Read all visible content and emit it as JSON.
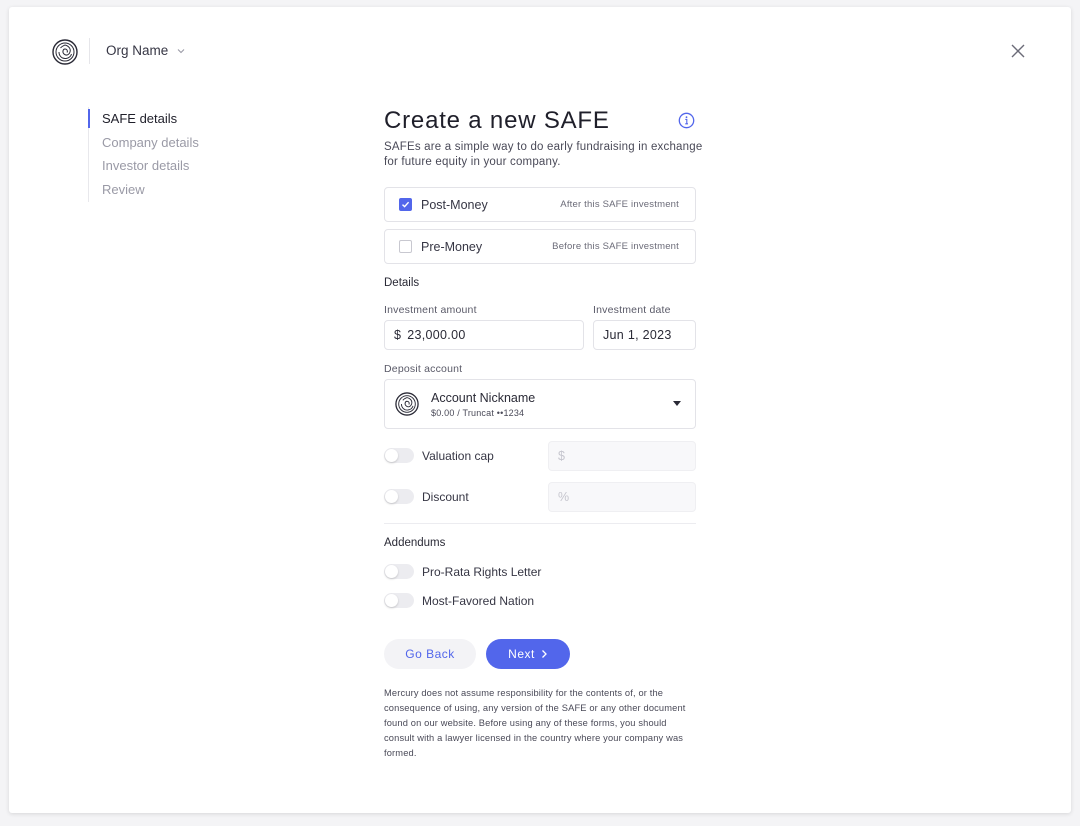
{
  "header": {
    "org_name": "Org Name"
  },
  "steps": [
    {
      "label": "SAFE details",
      "active": true
    },
    {
      "label": "Company details",
      "active": false
    },
    {
      "label": "Investor details",
      "active": false
    },
    {
      "label": "Review",
      "active": false
    }
  ],
  "form": {
    "title": "Create a new SAFE",
    "subtitle": "SAFEs are a simple way to do early fundraising in exchange for future equity in your company.",
    "options": [
      {
        "label": "Post-Money",
        "hint": "After this SAFE investment",
        "checked": true
      },
      {
        "label": "Pre-Money",
        "hint": "Before this SAFE investment",
        "checked": false
      }
    ],
    "details_label": "Details",
    "investment_amount": {
      "label": "Investment amount",
      "prefix": "$",
      "value": "23,000.00"
    },
    "investment_date": {
      "label": "Investment date",
      "value": "Jun 1, 2023"
    },
    "deposit_account": {
      "label": "Deposit account",
      "name": "Account Nickname",
      "sub": "$0.00  /  Truncat ••1234"
    },
    "valuation_cap": {
      "label": "Valuation cap",
      "placeholder": "$",
      "enabled": false
    },
    "discount": {
      "label": "Discount",
      "placeholder": "%",
      "enabled": false
    },
    "addendums_label": "Addendums",
    "addendums": [
      {
        "label": "Pro-Rata Rights Letter",
        "enabled": false
      },
      {
        "label": "Most-Favored Nation",
        "enabled": false
      }
    ],
    "back_label": "Go Back",
    "next_label": "Next",
    "disclaimer": "Mercury does not assume responsibility for the contents of, or the consequence of using, any version of the SAFE or any other document found on our website. Before using any of these forms, you should consult with a lawyer licensed in the country where your company was formed."
  },
  "colors": {
    "accent": "#5266eb",
    "text": "#363644",
    "muted": "#9a9aa6"
  }
}
